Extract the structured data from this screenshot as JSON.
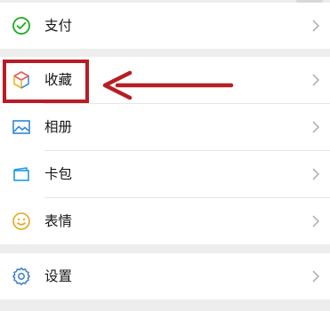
{
  "menu": {
    "pay": {
      "label": "支付",
      "icon": "pay-icon"
    },
    "favorites": {
      "label": "收藏",
      "icon": "cube-icon"
    },
    "album": {
      "label": "相册",
      "icon": "image-icon"
    },
    "cards": {
      "label": "卡包",
      "icon": "card-wallet-icon"
    },
    "stickers": {
      "label": "表情",
      "icon": "smiley-icon"
    },
    "settings": {
      "label": "设置",
      "icon": "gear-icon"
    }
  },
  "annotation": {
    "color": "#b81d24",
    "target": "favorites"
  },
  "colors": {
    "background": "#ededed",
    "card": "#ffffff",
    "pay_green": "#1aad19",
    "album_blue": "#2f87d8",
    "cards_teal": "#1e9be6",
    "stickers_yellow": "#e8a618",
    "settings_blue": "#3a7dc4"
  }
}
